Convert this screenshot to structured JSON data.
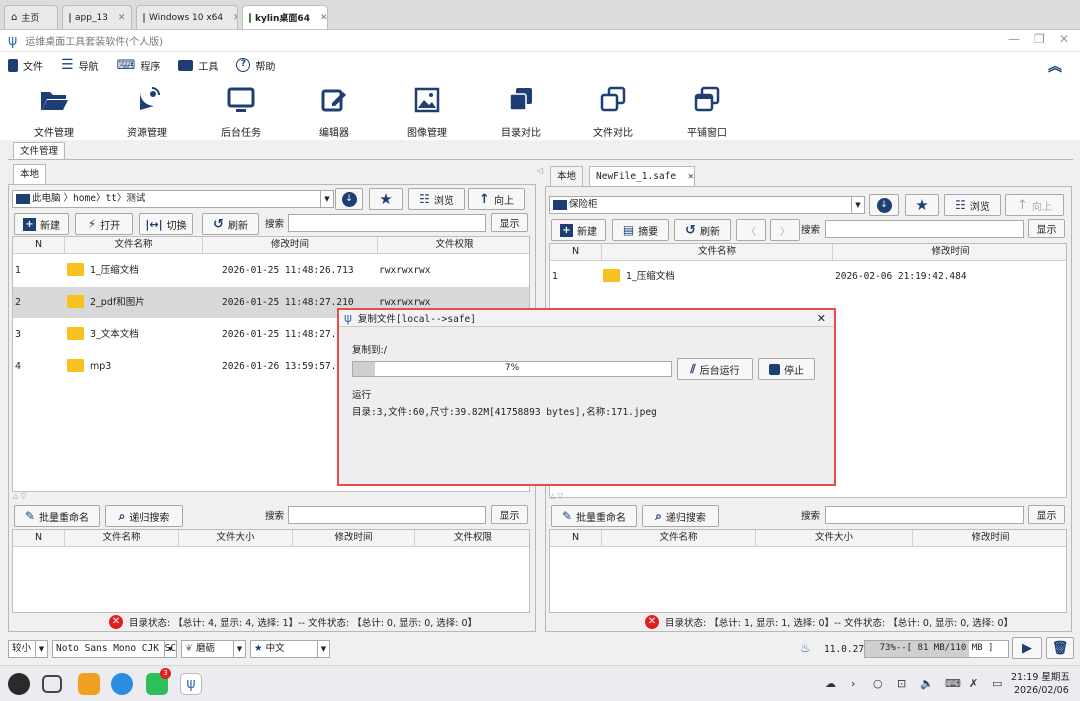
{
  "browser_tabs": [
    {
      "label": "主页"
    },
    {
      "label": "app_13"
    },
    {
      "label": "Windows 10 x64"
    },
    {
      "label": "kylin桌面64"
    }
  ],
  "window": {
    "title": "运维桌面工具套装软件(个人版)"
  },
  "menu": {
    "items": [
      "文件",
      "导航",
      "程序",
      "工具",
      "帮助"
    ]
  },
  "toolbar": {
    "tools": [
      "文件管理",
      "资源管理",
      "后台任务",
      "编辑器",
      "图像管理",
      "目录对比",
      "文件对比",
      "平铺窗口"
    ]
  },
  "main_tab": "文件管理",
  "left": {
    "tab": "本地",
    "path": [
      "此电脑",
      "home",
      "tt",
      "测试"
    ],
    "buttons": {
      "browse": "浏览",
      "up": "向上",
      "new": "新建",
      "open": "打开",
      "switch": "切换",
      "refresh": "刷新",
      "show": "显示"
    },
    "search_label": "搜索",
    "columns": [
      "N",
      "文件名称",
      "修改时间",
      "文件权限"
    ],
    "rows": [
      {
        "n": "1",
        "name": "1_压缩文档",
        "time": "2026-01-25 11:48:26.713",
        "perm": "rwxrwxrwx"
      },
      {
        "n": "2",
        "name": "2_pdf和图片",
        "time": "2026-01-25 11:48:27.210",
        "perm": "rwxrwxrwx"
      },
      {
        "n": "3",
        "name": "3_文本文档",
        "time": "2026-01-25 11:48:27.317",
        "perm": ""
      },
      {
        "n": "4",
        "name": "mp3",
        "time": "2026-01-26 13:59:57.850",
        "perm": ""
      }
    ],
    "lower": {
      "buttons": {
        "rename": "批量重命名",
        "recursive": "递归搜索",
        "show": "显示"
      },
      "search_label": "搜索",
      "columns": [
        "N",
        "文件名称",
        "文件大小",
        "修改时间",
        "文件权限"
      ]
    },
    "status": "目录状态: 【总计: 4, 显示: 4, 选择: 1】-- 文件状态: 【总计: 0, 显示: 0, 选择: 0】"
  },
  "right": {
    "tabs": [
      "本地",
      "NewFile_1.safe"
    ],
    "path": "保险柜",
    "buttons": {
      "browse": "浏览",
      "up": "向上",
      "new": "新建",
      "digest": "摘要",
      "refresh": "刷新",
      "show": "显示"
    },
    "search_label": "搜索",
    "columns": [
      "N",
      "文件名称",
      "修改时间"
    ],
    "rows": [
      {
        "n": "1",
        "name": "1_压缩文档",
        "time": "2026-02-06 21:19:42.484"
      }
    ],
    "lower": {
      "buttons": {
        "rename": "批量重命名",
        "recursive": "递归搜索",
        "show": "显示"
      },
      "search_label": "搜索",
      "columns": [
        "N",
        "文件名称",
        "文件大小",
        "修改时间"
      ]
    },
    "status": "目录状态: 【总计: 1, 显示: 1, 选择: 0】-- 文件状态: 【总计: 0, 显示: 0, 选择: 0】"
  },
  "dialog": {
    "title": "复制文件[local-->safe]",
    "copy_to": "复制到:/",
    "progress": 7,
    "progress_label": "7%",
    "bg_button": "后台运行",
    "stop_button": "停止",
    "state": "运行",
    "detail": "目录:3,文件:60,尺寸:39.82M[41758893 bytes],名称:171.jpeg"
  },
  "bottom": {
    "size": "较小",
    "font": "Noto Sans Mono CJK SC",
    "theme": "磨砺",
    "lang": "中文",
    "java_version": "11.0.27",
    "memory": "73%--[ 81 MB/110 MB ]",
    "memory_fraction": 0.73
  },
  "taskbar": {
    "badge": "3",
    "time": "21:19 星期五",
    "date": "2026/02/06"
  },
  "colors": {
    "accent": "#1d3f73",
    "folder": "#f7c21d",
    "dialog_border": "#e74c4c",
    "error": "#e02020"
  }
}
